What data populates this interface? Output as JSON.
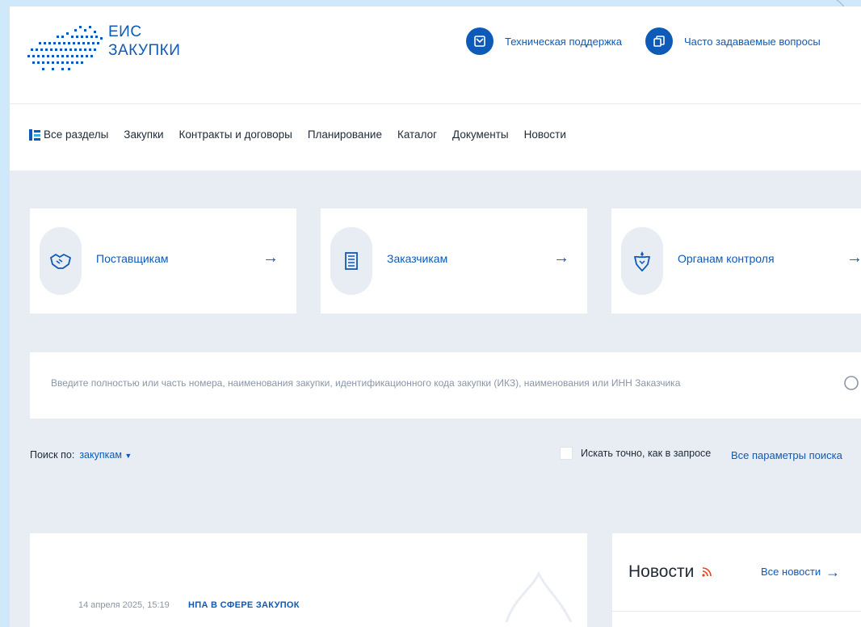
{
  "header": {
    "logo_line1": "ЕИС",
    "logo_line2": "ЗАКУПКИ",
    "support_label": "Техническая поддержка",
    "faq_label": "Часто задаваемые вопросы"
  },
  "nav": {
    "items": [
      "Все разделы",
      "Закупки",
      "Контракты и договоры",
      "Планирование",
      "Каталог",
      "Документы",
      "Новости"
    ]
  },
  "cards": [
    {
      "label": "Поставщикам",
      "arrow": "→"
    },
    {
      "label": "Заказчикам",
      "arrow": "→"
    },
    {
      "label": "Органам контроля",
      "arrow": "→"
    }
  ],
  "search": {
    "placeholder": "Введите полностью или часть номера, наименования закупки, идентификационного кода закупки (ИКЗ), наименования или ИНН Заказчика",
    "search_by_label": "Поиск по:",
    "search_by_value": "закупкам",
    "exact_label": "Искать точно, как в запросе",
    "all_params": "Все параметры поиска"
  },
  "news_main": {
    "date": "14 апреля 2025, 15:19",
    "category": "НПА В СФЕРЕ ЗАКУПОК"
  },
  "news_side": {
    "title": "Новости",
    "all_link": "Все новости"
  },
  "colors": {
    "accent": "#0d5ab8",
    "page_bg": "#e8edf3",
    "rss": "#e8431b"
  }
}
